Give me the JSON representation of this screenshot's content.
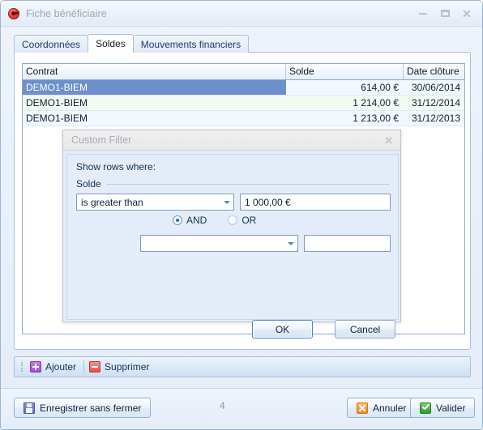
{
  "window": {
    "title": "Fiche bénéficiaire",
    "icon": "app-disc-icon",
    "minimize_label": "",
    "maximize_label": "",
    "close_label": "✕"
  },
  "tabs": [
    {
      "label": "Coordonnées",
      "active": false
    },
    {
      "label": "Soldes",
      "active": true
    },
    {
      "label": "Mouvements financiers",
      "active": false
    }
  ],
  "grid": {
    "columns": [
      "Contrat",
      "Solde",
      "Date clôture"
    ],
    "rows": [
      {
        "contrat": "DEMO1-BIEM",
        "solde": "614,00 €",
        "date": "30/06/2014",
        "selected": true
      },
      {
        "contrat": "DEMO1-BIEM",
        "solde": "1 214,00 €",
        "date": "31/12/2014",
        "selected": false
      },
      {
        "contrat": "DEMO1-BIEM",
        "solde": "1 213,00 €",
        "date": "31/12/2013",
        "selected": false
      }
    ]
  },
  "row_toolbar": {
    "add_label": "Ajouter",
    "delete_label": "Supprimer"
  },
  "bottom_bar": {
    "save_label": "Enregistrer sans fermer",
    "record_count": "4",
    "cancel_label": "Annuler",
    "validate_label": "Valider"
  },
  "dialog": {
    "title": "Custom Filter",
    "close_label": "✕",
    "show_rows_label": "Show rows where:",
    "field_label": "Solde",
    "condition1": {
      "operator": "is greater than",
      "value": "1 000,00 €"
    },
    "logic": {
      "and_label": "AND",
      "or_label": "OR",
      "selected": "AND"
    },
    "condition2": {
      "operator": "",
      "value": ""
    },
    "ok_label": "OK",
    "cancel_label": "Cancel"
  },
  "colors": {
    "accent": "#6d8fcd",
    "tab_text": "#1f3c6e",
    "title_text": "#9aa7b6",
    "grid_border": "#8fa9c6",
    "dialog_bg": "#e3ecf8"
  }
}
